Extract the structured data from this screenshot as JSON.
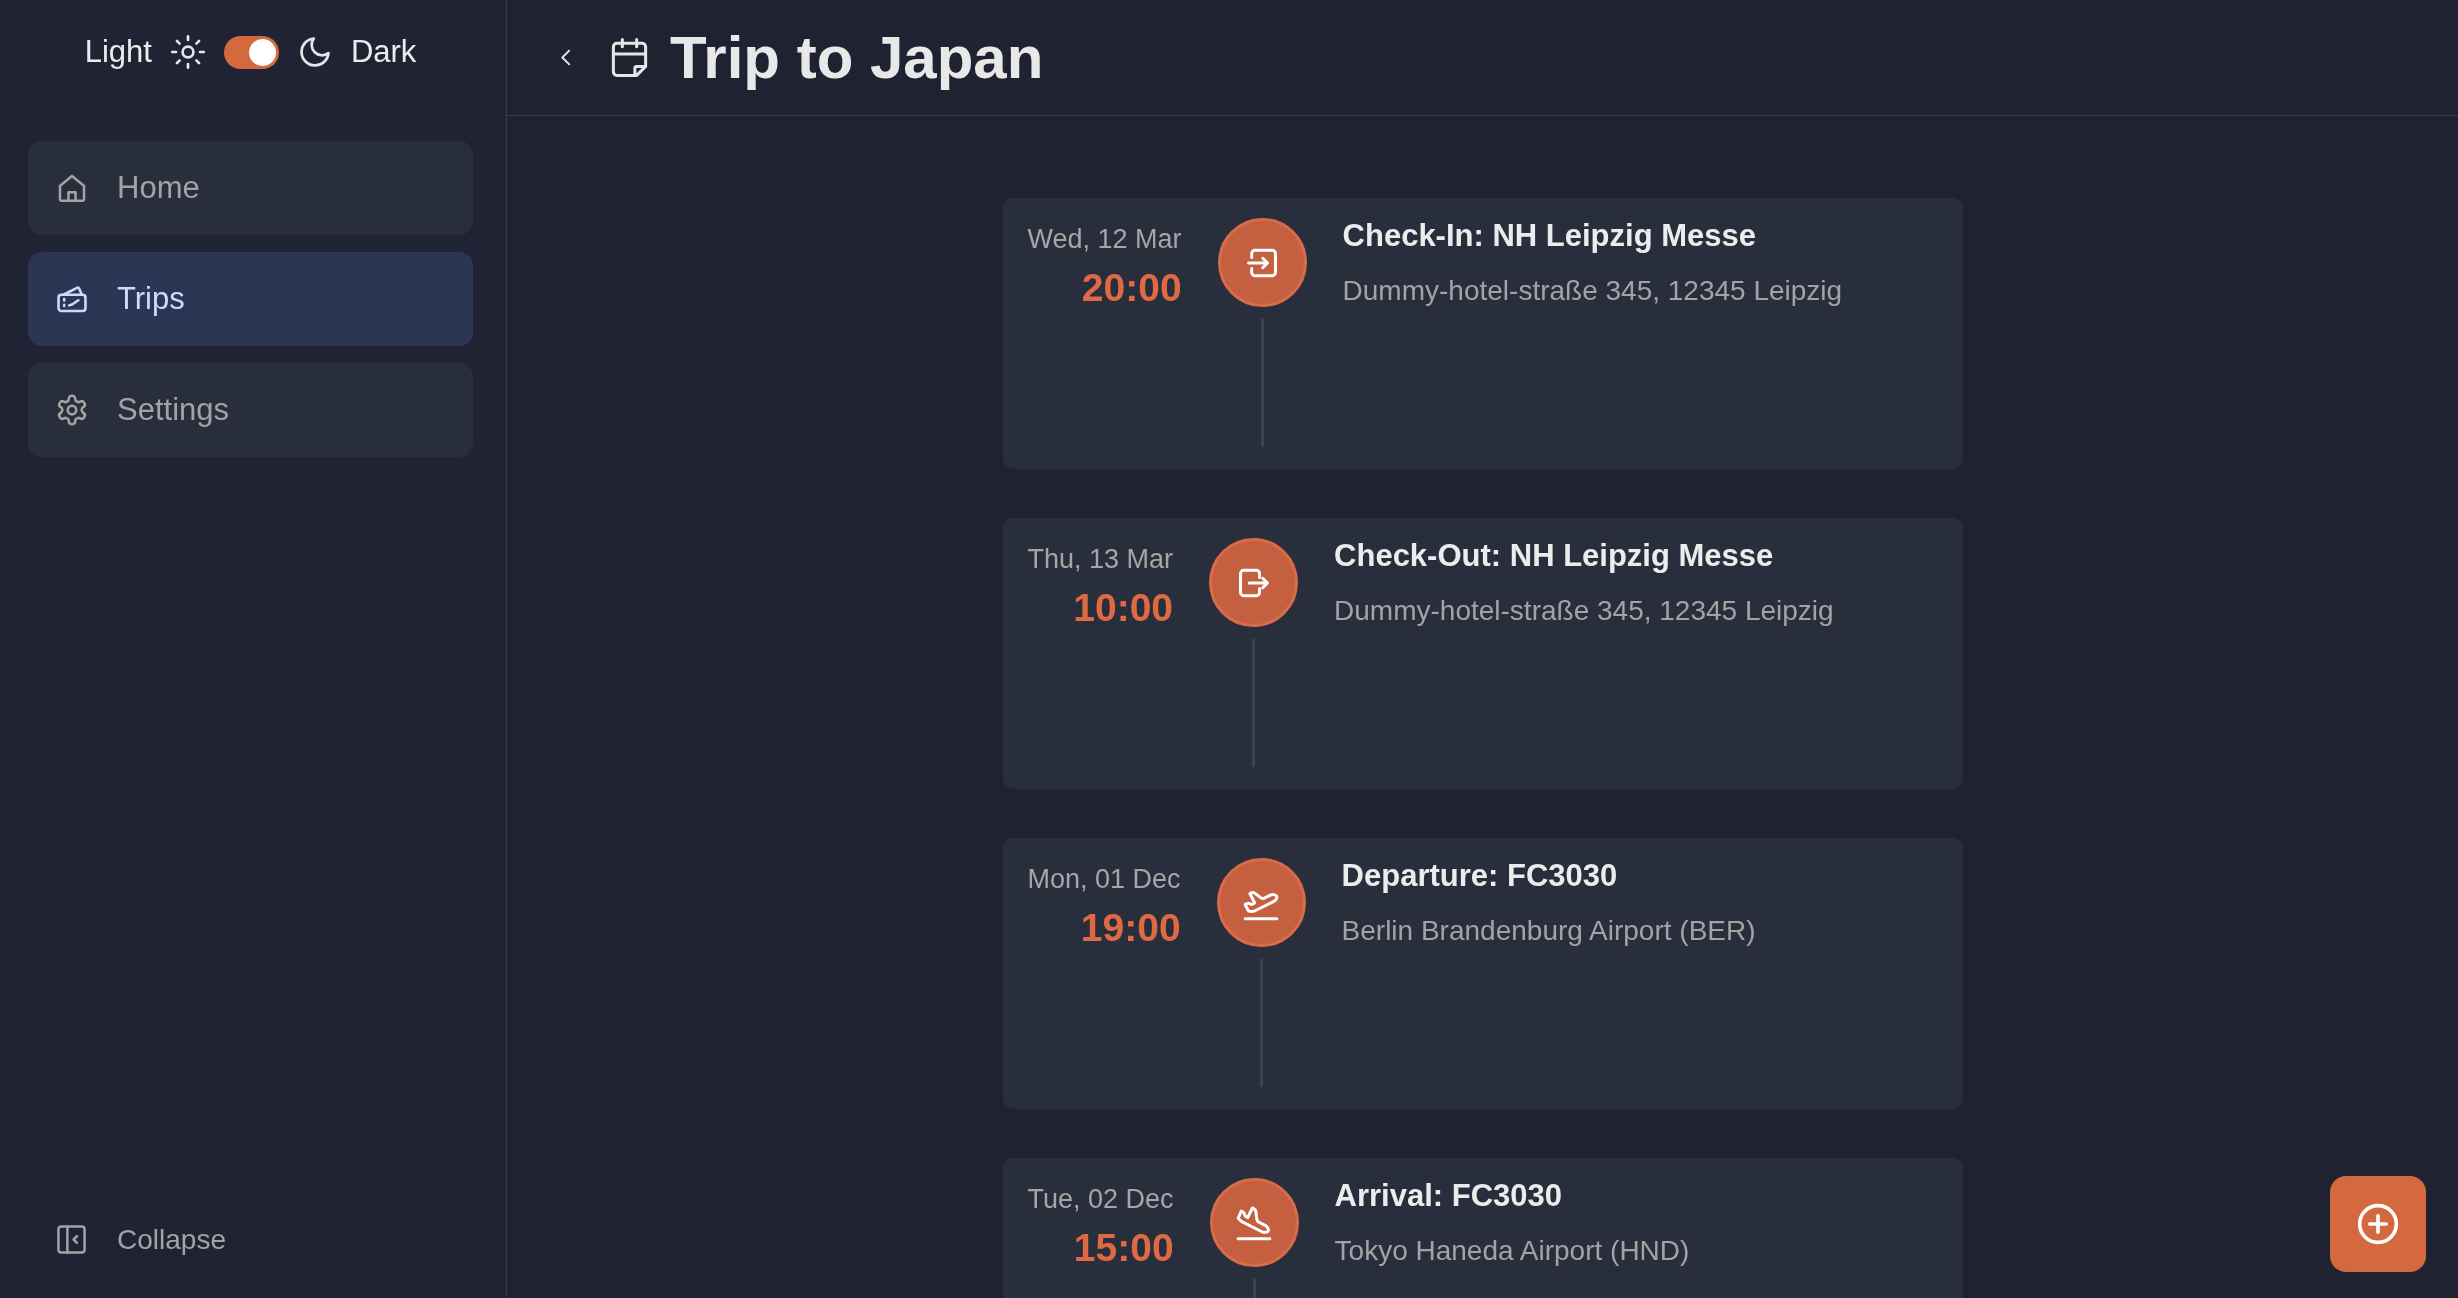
{
  "theme_toggle": {
    "light_label": "Light",
    "dark_label": "Dark",
    "on": true
  },
  "sidebar": {
    "items": [
      {
        "label": "Home",
        "selected": false
      },
      {
        "label": "Trips",
        "selected": true
      },
      {
        "label": "Settings",
        "selected": false
      }
    ],
    "collapse_label": "Collapse"
  },
  "header": {
    "title": "Trip to Japan"
  },
  "timeline": [
    {
      "kind": "check-in",
      "date": "Wed, 12 Mar",
      "time": "20:00",
      "title": "Check-In: NH Leipzig Messe",
      "address": "Dummy-hotel-straße 345, 12345 Leipzig"
    },
    {
      "kind": "check-out",
      "date": "Thu, 13 Mar",
      "time": "10:00",
      "title": "Check-Out: NH Leipzig Messe",
      "address": "Dummy-hotel-straße 345, 12345 Leipzig"
    },
    {
      "kind": "departure",
      "date": "Mon, 01 Dec",
      "time": "19:00",
      "title": "Departure: FC3030",
      "address": "Berlin Brandenburg Airport (BER)"
    },
    {
      "kind": "arrival",
      "date": "Tue, 02 Dec",
      "time": "15:00",
      "title": "Arrival: FC3030",
      "address": "Tokyo Haneda Airport (HND)"
    }
  ]
}
